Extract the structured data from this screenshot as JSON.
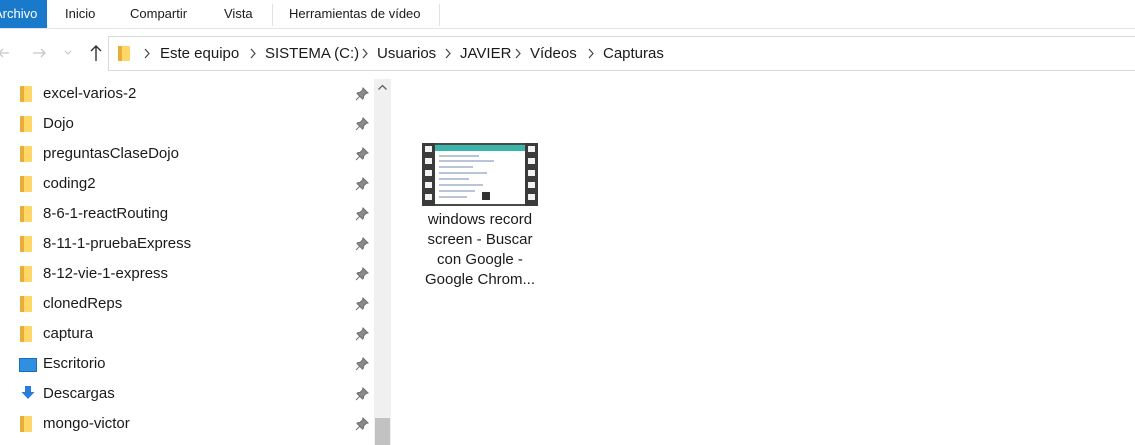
{
  "ribbon": {
    "tabs": [
      {
        "label": "Archivo"
      },
      {
        "label": "Inicio"
      },
      {
        "label": "Compartir"
      },
      {
        "label": "Vista"
      },
      {
        "label": "Herramientas de vídeo"
      }
    ],
    "file_tab_color": "#1979ca"
  },
  "address_bar": {
    "back_icon": "back-arrow-icon",
    "forward_icon": "forward-arrow-icon",
    "up_icon": "up-arrow-icon",
    "crumbs": [
      {
        "label": "Este equipo"
      },
      {
        "label": "SISTEMA (C:)"
      },
      {
        "label": "Usuarios"
      },
      {
        "label": "JAVIER"
      },
      {
        "label": "Vídeos"
      },
      {
        "label": "Capturas"
      }
    ]
  },
  "nav_pane": {
    "items": [
      {
        "label": "excel-varios-2",
        "icon": "folder-icon"
      },
      {
        "label": "Dojo",
        "icon": "folder-icon"
      },
      {
        "label": "preguntasClaseDojo",
        "icon": "folder-icon"
      },
      {
        "label": "coding2",
        "icon": "folder-icon"
      },
      {
        "label": "8-6-1-reactRouting",
        "icon": "folder-icon"
      },
      {
        "label": "8-11-1-pruebaExpress",
        "icon": "folder-icon"
      },
      {
        "label": "8-12-vie-1-express",
        "icon": "folder-icon"
      },
      {
        "label": "clonedReps",
        "icon": "folder-icon"
      },
      {
        "label": "captura",
        "icon": "folder-icon"
      },
      {
        "label": "Escritorio",
        "icon": "desktop-icon"
      },
      {
        "label": "Descargas",
        "icon": "downloads-icon"
      },
      {
        "label": "mongo-victor",
        "icon": "folder-icon"
      }
    ]
  },
  "content": {
    "files": [
      {
        "name": "windows record\nscreen - Buscar\ncon Google -\nGoogle Chrom...",
        "icon": "video-file-icon"
      }
    ]
  }
}
